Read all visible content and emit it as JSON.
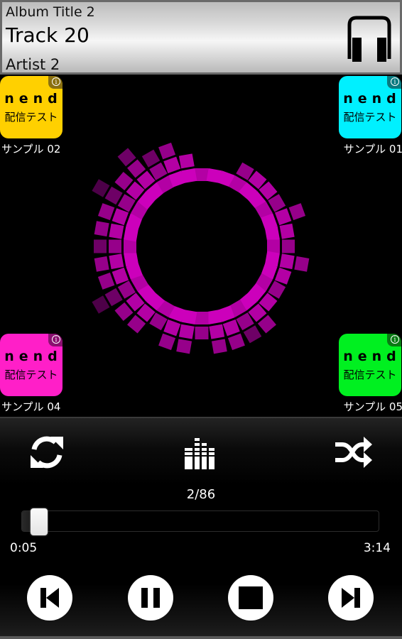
{
  "header": {
    "album": "Album Title 2",
    "track": "Track 20",
    "artist": "Artist 2",
    "icon": "headphones-icon"
  },
  "ads": [
    {
      "position": "top-left",
      "brand": "nend",
      "subtitle": "配信テスト",
      "label": "サンプル 02",
      "color": "#ffd000",
      "info_color": "#8a7010"
    },
    {
      "position": "top-right",
      "brand": "nend",
      "subtitle": "配信テスト",
      "label": "サンプル 01",
      "color": "#00f0ff",
      "info_color": "#0a7a80"
    },
    {
      "position": "bottom-left",
      "brand": "nend",
      "subtitle": "配信テスト",
      "label": "サンプル 04",
      "color": "#ff1fc8",
      "info_color": "#8a1070"
    },
    {
      "position": "bottom-right",
      "brand": "nend",
      "subtitle": "配信テスト",
      "label": "サンプル 05",
      "color": "#00f020",
      "info_color": "#0a7a14"
    }
  ],
  "visualizer": {
    "type": "radial-spectrum",
    "color": "#cc00bb",
    "bar_count": 36,
    "levels": [
      1,
      1,
      1,
      2,
      2,
      2,
      2,
      3,
      2,
      2,
      3,
      2,
      2,
      2,
      3,
      3,
      3,
      3,
      2,
      3,
      3,
      2,
      3,
      3,
      4,
      3,
      3,
      3,
      3,
      3,
      4,
      3,
      4,
      3,
      3,
      2
    ]
  },
  "controls": {
    "repeat_icon": "repeat-icon",
    "equalizer_icon": "equalizer-icon",
    "shuffle_icon": "shuffle-icon",
    "track_counter": "2/86",
    "current_time": "0:05",
    "total_time": "3:14",
    "progress": 0.026,
    "buttons": [
      "previous",
      "pause",
      "stop",
      "next"
    ]
  }
}
